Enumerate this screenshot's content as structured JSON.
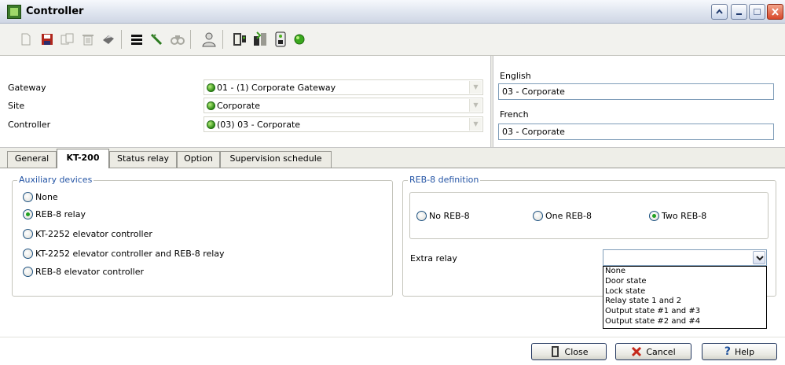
{
  "window": {
    "title": "Controller",
    "controls": [
      "help-icon",
      "minimize-icon",
      "maximize-icon",
      "close-icon"
    ]
  },
  "toolbar": {
    "icons": [
      "new-icon",
      "save-icon",
      "copy-icon",
      "delete-icon",
      "print-icon",
      "list-icon",
      "edit-icon",
      "find-icon",
      "user-icon",
      "door-icon",
      "download-icon",
      "controller-icon",
      "status-icon"
    ]
  },
  "header": {
    "gateway_label": "Gateway",
    "gateway_value": "01 - (1)  Corporate Gateway",
    "site_label": "Site",
    "site_value": "Corporate",
    "controller_label": "Controller",
    "controller_value": "(03) 03 - Corporate",
    "english_label": "English",
    "english_value": "03 - Corporate",
    "french_label": "French",
    "french_value": "03 - Corporate"
  },
  "tabs": [
    {
      "label": "General"
    },
    {
      "label": "KT-200"
    },
    {
      "label": "Status relay"
    },
    {
      "label": "Option"
    },
    {
      "label": "Supervision schedule"
    }
  ],
  "aux": {
    "title": "Auxiliary devices",
    "options": [
      {
        "label": "None",
        "checked": false
      },
      {
        "label": "REB-8 relay",
        "checked": true
      },
      {
        "label": "KT-2252 elevator controller",
        "checked": false
      },
      {
        "label": "KT-2252 elevator controller and REB-8 relay",
        "checked": false
      },
      {
        "label": "REB-8 elevator controller",
        "checked": false
      }
    ]
  },
  "reb8": {
    "title": "REB-8 definition",
    "options": [
      {
        "label": "No REB-8",
        "checked": false
      },
      {
        "label": "One REB-8",
        "checked": false
      },
      {
        "label": "Two REB-8",
        "checked": true
      }
    ],
    "extra_relay_label": "Extra relay",
    "extra_relay_value": "",
    "extra_relay_options": [
      "None",
      "Door state",
      "Lock state",
      "Relay state 1 and 2",
      "Output state #1 and #3",
      "Output state #2 and #4"
    ]
  },
  "buttons": {
    "close": "Close",
    "cancel": "Cancel",
    "help": "Help"
  },
  "colors": {
    "group_title": "#2555a5",
    "status_green": "#2f8c16",
    "radio_dot": "#21a121"
  }
}
